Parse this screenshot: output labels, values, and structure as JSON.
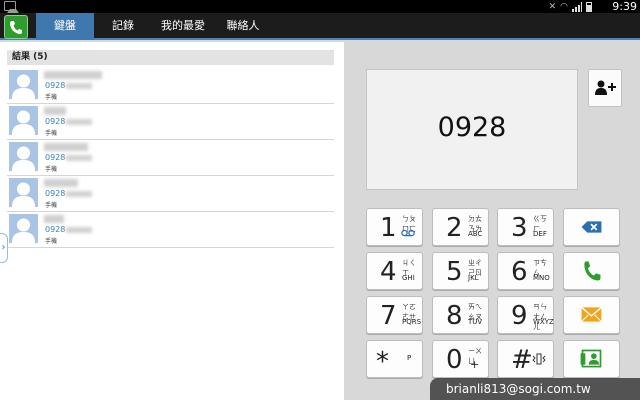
{
  "status_bar": {
    "time": "9:39"
  },
  "tabs": [
    {
      "label": "鍵盤",
      "active": true
    },
    {
      "label": "記錄",
      "active": false
    },
    {
      "label": "我的最愛",
      "active": false
    },
    {
      "label": "聯絡人",
      "active": false
    }
  ],
  "results": {
    "header": "結果 (5)",
    "contacts": [
      {
        "number_visible": "0928",
        "type": "手機"
      },
      {
        "number_visible": "0928",
        "type": "手機"
      },
      {
        "number_visible": "0928",
        "type": "手機"
      },
      {
        "number_visible": "0928",
        "type": "手機"
      },
      {
        "number_visible": "0928",
        "type": "手機"
      }
    ]
  },
  "dial": {
    "number": "0928",
    "keys": [
      {
        "digit": "1",
        "bopo": "ㄅㄆㄇㄈ",
        "letters": ""
      },
      {
        "digit": "2",
        "bopo": "ㄉㄊㄋㄌ",
        "letters": "ABC"
      },
      {
        "digit": "3",
        "bopo": "ㄍㄎㄏ",
        "letters": "DEF"
      },
      {
        "digit": "4",
        "bopo": "ㄐㄑㄒ",
        "letters": "GHI"
      },
      {
        "digit": "5",
        "bopo": "ㄓㄔㄕㄖ",
        "letters": "JKL"
      },
      {
        "digit": "6",
        "bopo": "ㄗㄘㄙ",
        "letters": "MNO"
      },
      {
        "digit": "7",
        "bopo": "ㄚㄛㄜㄝ",
        "letters": "PQRS"
      },
      {
        "digit": "8",
        "bopo": "ㄞㄟㄠㄡ",
        "letters": "TUV"
      },
      {
        "digit": "9",
        "bopo": "ㄢㄣㄤㄥㄦ",
        "letters": "WXYZ"
      },
      {
        "digit": "*",
        "bopo": "",
        "letters": "P"
      },
      {
        "digit": "0",
        "bopo": "ㄧㄨㄩ",
        "letters": "+"
      },
      {
        "digit": "#",
        "bopo": "",
        "letters": ""
      }
    ]
  },
  "watermark": "brianli813@sogi.com.tw",
  "colors": {
    "accent": "#3f78ad",
    "call_green": "#2e9d2e",
    "delete_blue": "#2a6fb0",
    "message_orange": "#f2a51c"
  }
}
